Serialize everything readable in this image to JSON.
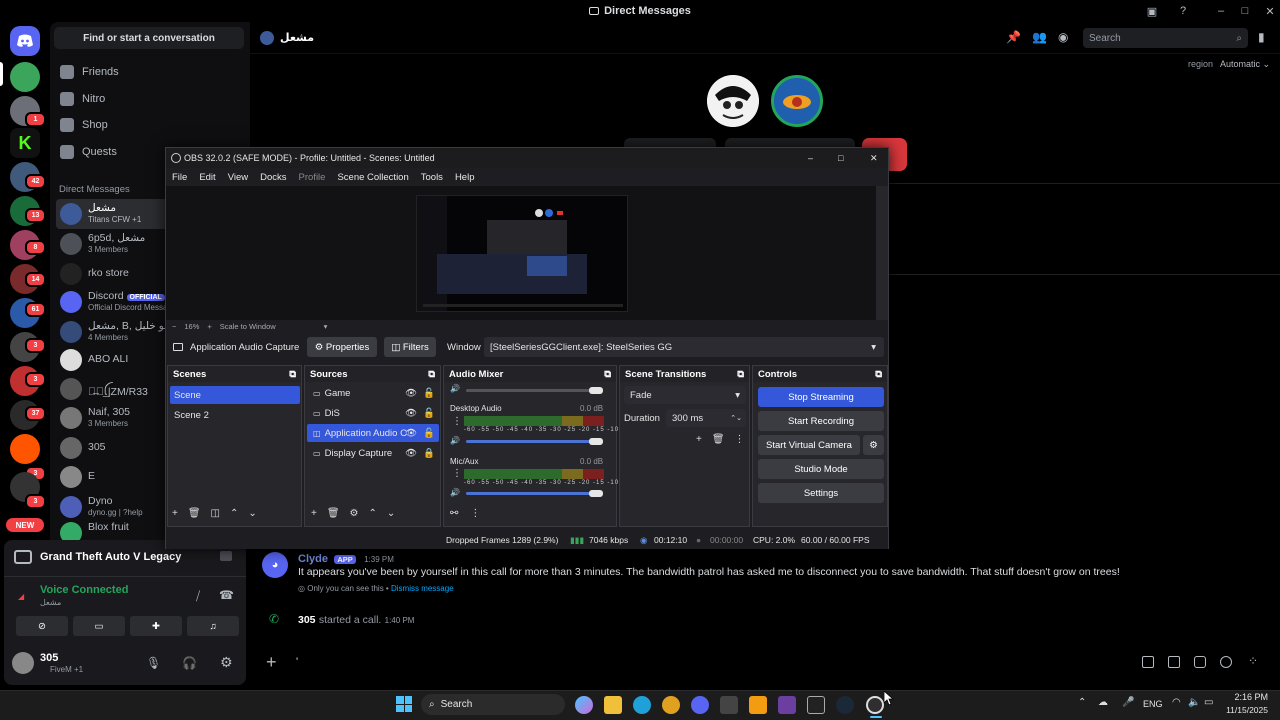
{
  "titlebar": {
    "title": "Direct Messages"
  },
  "servers": {
    "badges": [
      "1",
      "42",
      "13",
      "8",
      "14",
      "61",
      "3",
      "3",
      "37",
      "3",
      "3"
    ],
    "new_label": "NEW"
  },
  "dmlist": {
    "find_label": "Find or start a conversation",
    "nav": [
      "Friends",
      "Nitro",
      "Shop",
      "Quests"
    ],
    "section_label": "Direct Messages",
    "items": [
      {
        "name": "مشعل",
        "sub": "Titans CFW +1"
      },
      {
        "name": "6p5d, مشعل",
        "sub": "3 Members"
      },
      {
        "name": "rko store",
        "sub": ""
      },
      {
        "name": "Discord",
        "badge": "OFFICIAL",
        "sub": "Official Discord Message"
      },
      {
        "name": "مشعل, B, ابو خليل",
        "sub": "4 Members"
      },
      {
        "name": "ABO ALI",
        "sub": ""
      },
      {
        "name": "ꪜ̶ꪖ͢ꪶ|ZM/R33",
        "sub": ""
      },
      {
        "name": "Naif, 305",
        "sub": "3 Members"
      },
      {
        "name": "305",
        "sub": ""
      },
      {
        "name": "E",
        "sub": ""
      },
      {
        "name": "Dyno",
        "sub": "dyno.gg | ?help"
      },
      {
        "name": "Blox fruit",
        "sub": ""
      }
    ]
  },
  "activity": {
    "game": "Grand Theft Auto V Legacy"
  },
  "voice": {
    "status": "Voice Connected",
    "channel": "مشعل"
  },
  "user": {
    "name": "305",
    "status": "FiveM +1"
  },
  "header": {
    "dm_name": "مشعل",
    "search_placeholder": "Search",
    "region_label": "region",
    "region_value": "Automatic"
  },
  "obs": {
    "title": "OBS 32.0.2 (SAFE MODE) - Profile: Untitled - Scenes: Untitled",
    "menu": [
      "File",
      "Edit",
      "View",
      "Docks",
      "Profile",
      "Scene Collection",
      "Tools",
      "Help"
    ],
    "zoom": "16%",
    "scale_mode": "Scale to Window",
    "source_bar": {
      "name": "Application Audio Capture",
      "properties": "Properties",
      "filters": "Filters",
      "window_label": "Window",
      "window_value": "[SteelSeriesGGClient.exe]: SteelSeries GG"
    },
    "scenes": {
      "title": "Scenes",
      "items": [
        "Scene",
        "Scene 2"
      ]
    },
    "sources": {
      "title": "Sources",
      "items": [
        "Game",
        "DiS",
        "Application Audio C",
        "Display Capture"
      ]
    },
    "mixer": {
      "title": "Audio Mixer",
      "channels": [
        {
          "name": "Desktop Audio",
          "db": "0.0 dB"
        },
        {
          "name": "Mic/Aux",
          "db": "0.0 dB"
        }
      ],
      "scale": "-60 -55 -50 -45 -40 -35 -30 -25 -20 -15 -10 -5 0"
    },
    "transitions": {
      "title": "Scene Transitions",
      "value": "Fade",
      "duration_label": "Duration",
      "duration_value": "300 ms"
    },
    "controls": {
      "title": "Controls",
      "buttons": [
        "Stop Streaming",
        "Start Recording",
        "Start Virtual Camera",
        "Studio Mode",
        "Settings"
      ]
    },
    "status": {
      "dropped": "Dropped Frames 1289 (2.9%)",
      "bitrate": "7046 kbps",
      "live": "00:12:10",
      "rec": "00:00:00",
      "cpu": "CPU: 2.0%",
      "fps": "60.00 / 60.00 FPS"
    }
  },
  "messages": {
    "bot_name": "Clyde",
    "bot_tag": "APP",
    "bot_time": "1:39 PM",
    "bot_text": "It appears you've been by yourself in this call for more than 3 minutes. The bandwidth patrol has asked me to disconnect you to save bandwidth. That stuff doesn't grow on trees!",
    "only_you": "Only you can see this •",
    "dismiss": "Dismiss message",
    "call_user": "305",
    "call_text": "started a call.",
    "call_time": "1:40 PM"
  },
  "composer": {
    "value": "'"
  },
  "taskbar": {
    "search": "Search",
    "lang": "ENG",
    "time": "2:16 PM",
    "date": "11/15/2025"
  },
  "colors": {
    "blurple": "#5865f2",
    "obs_accent": "#3557d9",
    "red": "#f23f43",
    "green": "#23a55a"
  }
}
